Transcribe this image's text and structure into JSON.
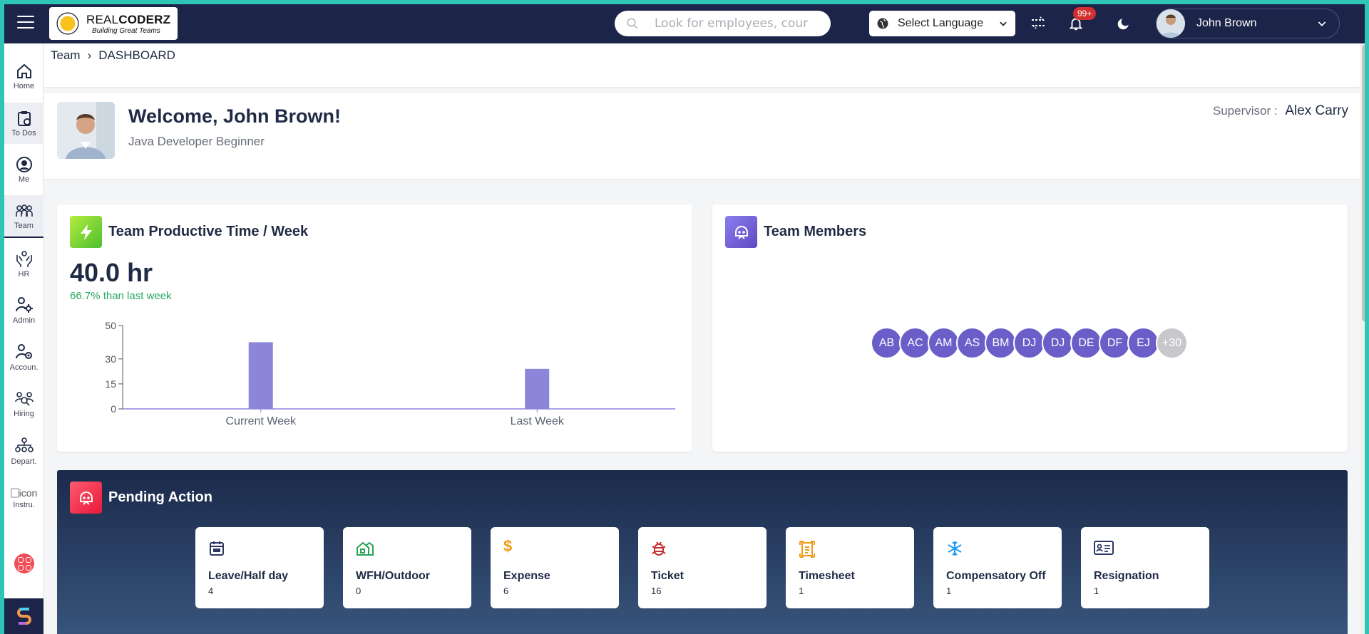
{
  "header": {
    "brand_light": "REAL",
    "brand_bold": "CODERZ",
    "tagline": "Building Great Teams",
    "search_placeholder": "Look for employees, cour",
    "language_label": "Select Language",
    "notification_count": "99+",
    "user_name": "John Brown"
  },
  "sidebar": {
    "items": [
      {
        "label": "Home",
        "icon": "home-icon"
      },
      {
        "label": "To Dos",
        "icon": "clipboard-icon"
      },
      {
        "label": "Me",
        "icon": "user-icon"
      },
      {
        "label": "Team",
        "icon": "team-icon"
      },
      {
        "label": "HR",
        "icon": "hands-icon"
      },
      {
        "label": "Admin",
        "icon": "admin-gear-icon"
      },
      {
        "label": "Accoun.",
        "icon": "account-icon"
      },
      {
        "label": "Hiring",
        "icon": "hiring-icon"
      },
      {
        "label": "Depart.",
        "icon": "department-icon"
      },
      {
        "label": "Instru.",
        "icon": "broken-image-icon",
        "alt": "icon"
      }
    ],
    "active": "Team"
  },
  "breadcrumb": {
    "root": "Team",
    "current": "DASHBOARD"
  },
  "welcome": {
    "greeting": "Welcome, John Brown!",
    "role": "Java Developer Beginner",
    "supervisor_label": "Supervisor :",
    "supervisor_name": "Alex Carry"
  },
  "productive": {
    "title": "Team Productive Time / Week",
    "value": "40.0 hr",
    "delta": "66.7% than last week"
  },
  "chart_data": {
    "type": "bar",
    "categories": [
      "Current Week",
      "Last Week"
    ],
    "values": [
      40,
      24
    ],
    "yticks": [
      0,
      15,
      30,
      50
    ],
    "ylim": [
      0,
      50
    ],
    "bar_color": "#8b86d9"
  },
  "members": {
    "title": "Team Members",
    "avatars": [
      "AB",
      "AC",
      "AM",
      "AS",
      "BM",
      "DJ",
      "DJ",
      "DE",
      "DF",
      "EJ"
    ],
    "more": "+30"
  },
  "pending": {
    "title": "Pending Action",
    "tiles": [
      {
        "label": "Leave/Half day",
        "count": "4",
        "icon": "calendar-icon",
        "color": "#2b3566"
      },
      {
        "label": "WFH/Outdoor",
        "count": "0",
        "icon": "wfh-house-icon",
        "color": "#27a35a"
      },
      {
        "label": "Expense",
        "count": "6",
        "icon": "dollar-icon",
        "color": "#f29b16"
      },
      {
        "label": "Ticket",
        "count": "16",
        "icon": "bug-icon",
        "color": "#c62f2f"
      },
      {
        "label": "Timesheet",
        "count": "1",
        "icon": "timesheet-icon",
        "color": "#f29b16"
      },
      {
        "label": "Compensatory Off",
        "count": "1",
        "icon": "snowflake-icon",
        "color": "#1d9bf0"
      },
      {
        "label": "Resignation",
        "count": "1",
        "icon": "id-card-icon",
        "color": "#2b3566"
      }
    ]
  }
}
